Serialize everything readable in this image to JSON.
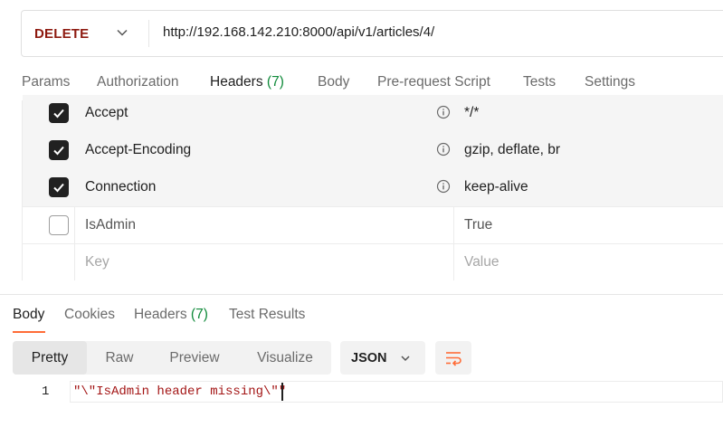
{
  "request": {
    "method": "DELETE",
    "url": "http://192.168.142.210:8000/api/v1/articles/4/"
  },
  "request_tabs": [
    {
      "label": "Params"
    },
    {
      "label": "Authorization"
    },
    {
      "label": "Headers",
      "count": "(7)",
      "active": true
    },
    {
      "label": "Body"
    },
    {
      "label": "Pre-request Script"
    },
    {
      "label": "Tests"
    },
    {
      "label": "Settings"
    }
  ],
  "headers": [
    {
      "key": "Accept",
      "value": "*/*",
      "checked": true,
      "auto": true
    },
    {
      "key": "Accept-Encoding",
      "value": "gzip, deflate, br",
      "checked": true,
      "auto": true
    },
    {
      "key": "Connection",
      "value": "keep-alive",
      "checked": true,
      "auto": true
    },
    {
      "key": "IsAdmin",
      "value": "True",
      "checked": false,
      "auto": false
    }
  ],
  "new_header": {
    "key_placeholder": "Key",
    "value_placeholder": "Value"
  },
  "response_tabs": [
    {
      "label": "Body",
      "active": true
    },
    {
      "label": "Cookies"
    },
    {
      "label": "Headers",
      "count": "(7)"
    },
    {
      "label": "Test Results"
    }
  ],
  "view_modes": [
    {
      "label": "Pretty",
      "active": true
    },
    {
      "label": "Raw"
    },
    {
      "label": "Preview"
    },
    {
      "label": "Visualize"
    }
  ],
  "format": {
    "selected": "JSON"
  },
  "response_body": {
    "lines": [
      {
        "number": "1",
        "text": "\"\\\"IsAdmin header missing\\\"\""
      }
    ]
  },
  "colors": {
    "method": "#8e1a10",
    "accent": "#ff6c37",
    "count": "#0f8a3a",
    "string": "#a31515"
  }
}
